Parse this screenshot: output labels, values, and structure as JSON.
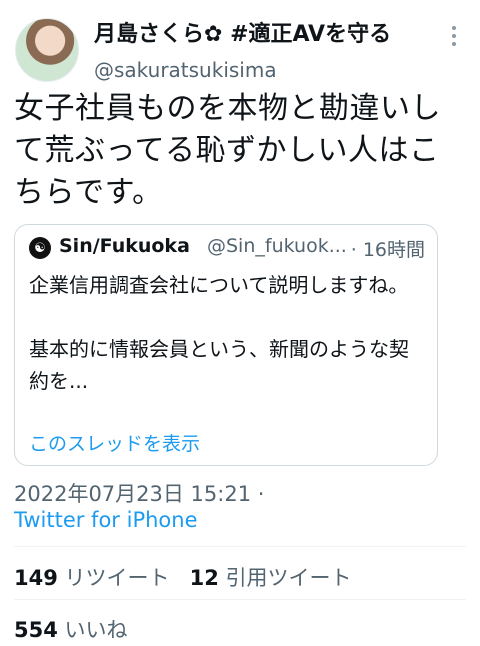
{
  "author": {
    "display_name": "月島さくら✿ #適正AVを守る",
    "username": "@sakuratsukisima"
  },
  "tweet": {
    "text": "女子社員ものを本物と勘違いして荒ぶってる恥ずかしい人はこちらです。"
  },
  "quote": {
    "display_name": "Sin/Fukuoka",
    "username": "@Sin_fukuok...",
    "time": "· 16時間",
    "text": "企業信用調査会社について説明しますね。\n\n基本的に情報会員という、新聞のような契約を...",
    "show_thread_link": "このスレッドを表示"
  },
  "meta": {
    "timestamp": "2022年07月23日 15:21 ·",
    "source": "Twitter for iPhone"
  },
  "stats": {
    "retweets_count": "149",
    "retweets_label": "リツイート",
    "quotes_count": "12",
    "quotes_label": "引用ツイート",
    "likes_count": "554",
    "likes_label": "いいね"
  },
  "icons": {
    "more": "more-icon",
    "quote_avatar": "avatar-icon"
  }
}
